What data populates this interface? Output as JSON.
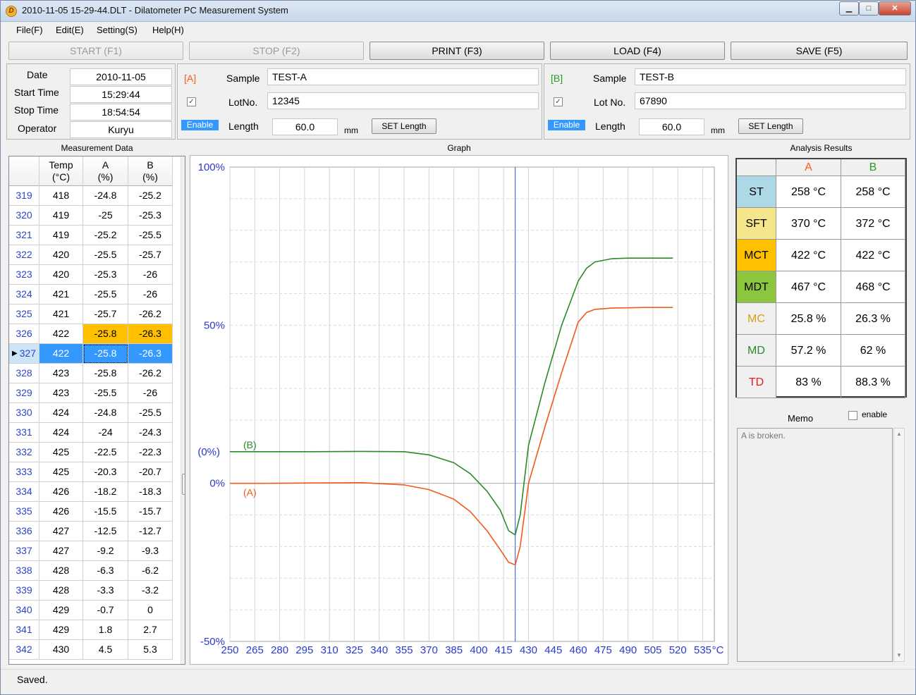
{
  "window": {
    "title": "2010-11-05 15-29-44.DLT - Dilatometer PC Measurement System",
    "min_glyph": "▁",
    "max_glyph": "□",
    "close_glyph": "✕"
  },
  "menu": [
    {
      "label": "File(F)"
    },
    {
      "label": "Edit(E)"
    },
    {
      "label": "Setting(S)"
    },
    {
      "label": "Help(H)"
    }
  ],
  "toolbar": {
    "start": "START (F1)",
    "stop": "STOP (F2)",
    "print": "PRINT (F3)",
    "load": "LOAD (F4)",
    "save": "SAVE (F5)"
  },
  "info": {
    "date_label": "Date",
    "date": "2010-11-05",
    "start_label": "Start Time",
    "start": "15:29:44",
    "stop_label": "Stop Time",
    "stop": "18:54:54",
    "operator_label": "Operator",
    "operator": "Kuryu"
  },
  "sample_a": {
    "tag": "[A]",
    "sample_label": "Sample",
    "sample": "TEST-A",
    "lot_label": "LotNo.",
    "lot": "12345",
    "checked": "✓",
    "enable": "Enable",
    "length_label": "Length",
    "length": "60.0",
    "unit": "mm",
    "set_length": "SET Length",
    "color": "#ff5a1a"
  },
  "sample_b": {
    "tag": "[B]",
    "sample_label": "Sample",
    "sample": "TEST-B",
    "lot_label": "Lot No.",
    "lot": "67890",
    "checked": "✓",
    "enable": "Enable",
    "length_label": "Length",
    "length": "60.0",
    "unit": "mm",
    "set_length": "SET Length",
    "color": "#2a9a2a"
  },
  "panels": {
    "measurement": "Measurement Data",
    "graph": "Graph",
    "analysis": "Analysis Results",
    "memo": "Memo",
    "memo_enable": "enable"
  },
  "table": {
    "headers": [
      "Temp\n(°C)",
      "A\n(%)",
      "B\n(%)"
    ],
    "rows": [
      [
        "319",
        "418",
        "-24.8",
        "-25.2"
      ],
      [
        "320",
        "419",
        "-25",
        "-25.3"
      ],
      [
        "321",
        "419",
        "-25.2",
        "-25.5"
      ],
      [
        "322",
        "420",
        "-25.5",
        "-25.7"
      ],
      [
        "323",
        "420",
        "-25.3",
        "-26"
      ],
      [
        "324",
        "421",
        "-25.5",
        "-26"
      ],
      [
        "325",
        "421",
        "-25.7",
        "-26.2"
      ],
      [
        "326",
        "422",
        "-25.8",
        "-26.3"
      ],
      [
        "327",
        "422",
        "-25.8",
        "-26.3"
      ],
      [
        "328",
        "423",
        "-25.8",
        "-26.2"
      ],
      [
        "329",
        "423",
        "-25.5",
        "-26"
      ],
      [
        "330",
        "424",
        "-24.8",
        "-25.5"
      ],
      [
        "331",
        "424",
        "-24",
        "-24.3"
      ],
      [
        "332",
        "425",
        "-22.5",
        "-22.3"
      ],
      [
        "333",
        "425",
        "-20.3",
        "-20.7"
      ],
      [
        "334",
        "426",
        "-18.2",
        "-18.3"
      ],
      [
        "335",
        "426",
        "-15.5",
        "-15.7"
      ],
      [
        "336",
        "427",
        "-12.5",
        "-12.7"
      ],
      [
        "337",
        "427",
        "-9.2",
        "-9.3"
      ],
      [
        "338",
        "428",
        "-6.3",
        "-6.2"
      ],
      [
        "339",
        "428",
        "-3.3",
        "-3.2"
      ],
      [
        "340",
        "429",
        "-0.7",
        "0"
      ],
      [
        "341",
        "429",
        "1.8",
        "2.7"
      ],
      [
        "342",
        "430",
        "4.5",
        "5.3"
      ]
    ],
    "highlight_row": "326",
    "selected_row": "327",
    "highlight_color": "#ffc000",
    "selected_color": "#3399ff"
  },
  "chart_data": {
    "type": "line",
    "xlabel": "°C",
    "x_ticks": [
      250,
      265,
      280,
      295,
      310,
      325,
      340,
      355,
      370,
      385,
      400,
      415,
      430,
      445,
      460,
      475,
      490,
      505,
      520,
      535
    ],
    "xlim": [
      250,
      542
    ],
    "ylim": [
      -50,
      100
    ],
    "y_ticks": [
      {
        "value": 100,
        "label": "100%"
      },
      {
        "value": 50,
        "label": "50%"
      },
      {
        "value": 0,
        "label": "0%"
      },
      {
        "value": -50,
        "label": "-50%"
      }
    ],
    "b_zero": {
      "value": 10,
      "label": "(0%)"
    },
    "cursor_x": 422,
    "grid": true,
    "series": [
      {
        "name": "(A)",
        "color": "#f05a1a",
        "x": [
          250,
          270,
          300,
          330,
          355,
          370,
          385,
          395,
          405,
          413,
          418,
          422,
          425,
          430,
          440,
          450,
          460,
          465,
          470,
          480,
          490,
          500,
          510,
          517
        ],
        "y": [
          0,
          0,
          0.1,
          0.2,
          -0.5,
          -2,
          -5,
          -9,
          -15,
          -21,
          -25,
          -25.8,
          -20,
          0,
          18,
          35,
          51,
          54,
          55,
          55.4,
          55.5,
          55.6,
          55.6,
          55.6
        ]
      },
      {
        "name": "(B)",
        "color": "#2a8a2a",
        "x": [
          250,
          270,
          300,
          330,
          355,
          370,
          385,
          395,
          405,
          413,
          418,
          422,
          425,
          430,
          440,
          450,
          460,
          465,
          470,
          480,
          490,
          500,
          510,
          517
        ],
        "y": [
          10,
          10,
          10,
          10.1,
          10,
          9,
          6.5,
          3,
          -2.5,
          -8.5,
          -15,
          -16.3,
          -10,
          12,
          32,
          50,
          64,
          68,
          70,
          71,
          71.2,
          71.2,
          71.2,
          71.2
        ]
      }
    ]
  },
  "analysis": {
    "col_a": "A",
    "col_b": "B",
    "rows": [
      {
        "label": "ST",
        "a": "258 °C",
        "b": "258 °C",
        "bg": "#add8e6",
        "fg": "#000000"
      },
      {
        "label": "SFT",
        "a": "370 °C",
        "b": "372 °C",
        "bg": "#f5e68c",
        "fg": "#000000"
      },
      {
        "label": "MCT",
        "a": "422 °C",
        "b": "422 °C",
        "bg": "#ffc000",
        "fg": "#000000"
      },
      {
        "label": "MDT",
        "a": "467 °C",
        "b": "468 °C",
        "bg": "#8cc63f",
        "fg": "#000000"
      },
      {
        "label": "MC",
        "a": "25.8 %",
        "b": "26.3 %",
        "bg": "#f0f0f0",
        "fg": "#d4a017"
      },
      {
        "label": "MD",
        "a": "57.2 %",
        "b": "62 %",
        "bg": "#f0f0f0",
        "fg": "#2a8a2a"
      },
      {
        "label": "TD",
        "a": "83 %",
        "b": "88.3 %",
        "bg": "#f0f0f0",
        "fg": "#e02020"
      }
    ]
  },
  "memo": {
    "text": "A is broken."
  },
  "status": "Saved."
}
